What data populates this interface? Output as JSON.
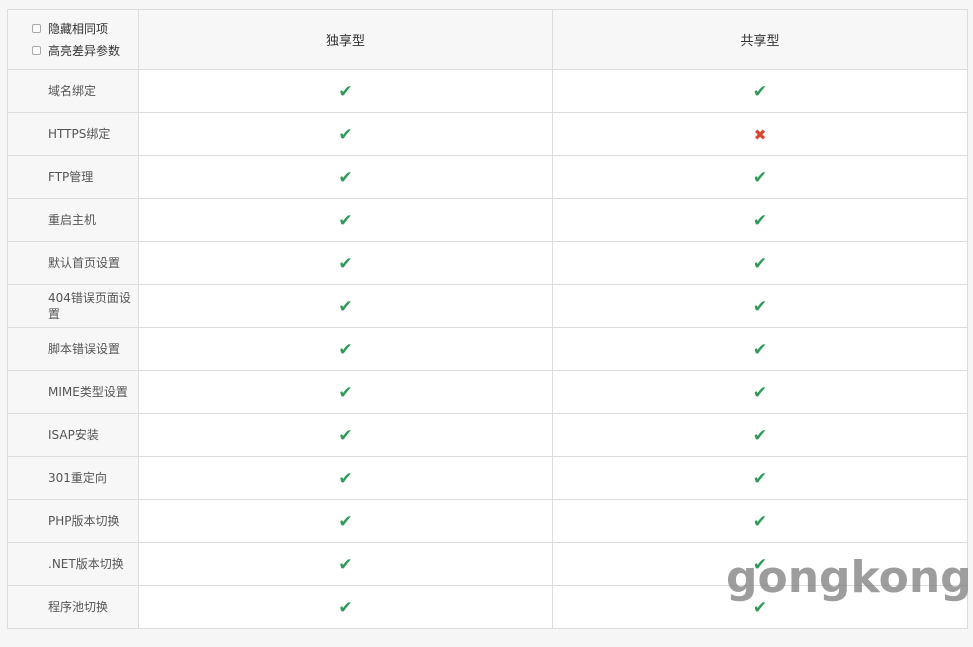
{
  "options": {
    "hide_same_label": "隐藏相同项",
    "highlight_diff_label": "高亮差异参数"
  },
  "columns": [
    "独享型",
    "共享型"
  ],
  "symbols": {
    "yes": "✔",
    "no": "✖"
  },
  "colors": {
    "yes": "#2e9b59",
    "no": "#d9452f"
  },
  "rows": [
    {
      "label": "域名绑定",
      "values": [
        "yes",
        "yes"
      ]
    },
    {
      "label": "HTTPS绑定",
      "values": [
        "yes",
        "no"
      ]
    },
    {
      "label": "FTP管理",
      "values": [
        "yes",
        "yes"
      ]
    },
    {
      "label": "重启主机",
      "values": [
        "yes",
        "yes"
      ]
    },
    {
      "label": "默认首页设置",
      "values": [
        "yes",
        "yes"
      ]
    },
    {
      "label": "404错误页面设置",
      "values": [
        "yes",
        "yes"
      ]
    },
    {
      "label": "脚本错误设置",
      "values": [
        "yes",
        "yes"
      ]
    },
    {
      "label": "MIME类型设置",
      "values": [
        "yes",
        "yes"
      ]
    },
    {
      "label": "ISAP安装",
      "values": [
        "yes",
        "yes"
      ]
    },
    {
      "label": "301重定向",
      "values": [
        "yes",
        "yes"
      ]
    },
    {
      "label": "PHP版本切换",
      "values": [
        "yes",
        "yes"
      ]
    },
    {
      "label": ".NET版本切换",
      "values": [
        "yes",
        "yes"
      ]
    },
    {
      "label": "程序池切换",
      "values": [
        "yes",
        "yes"
      ]
    }
  ],
  "watermark": "gongkong"
}
